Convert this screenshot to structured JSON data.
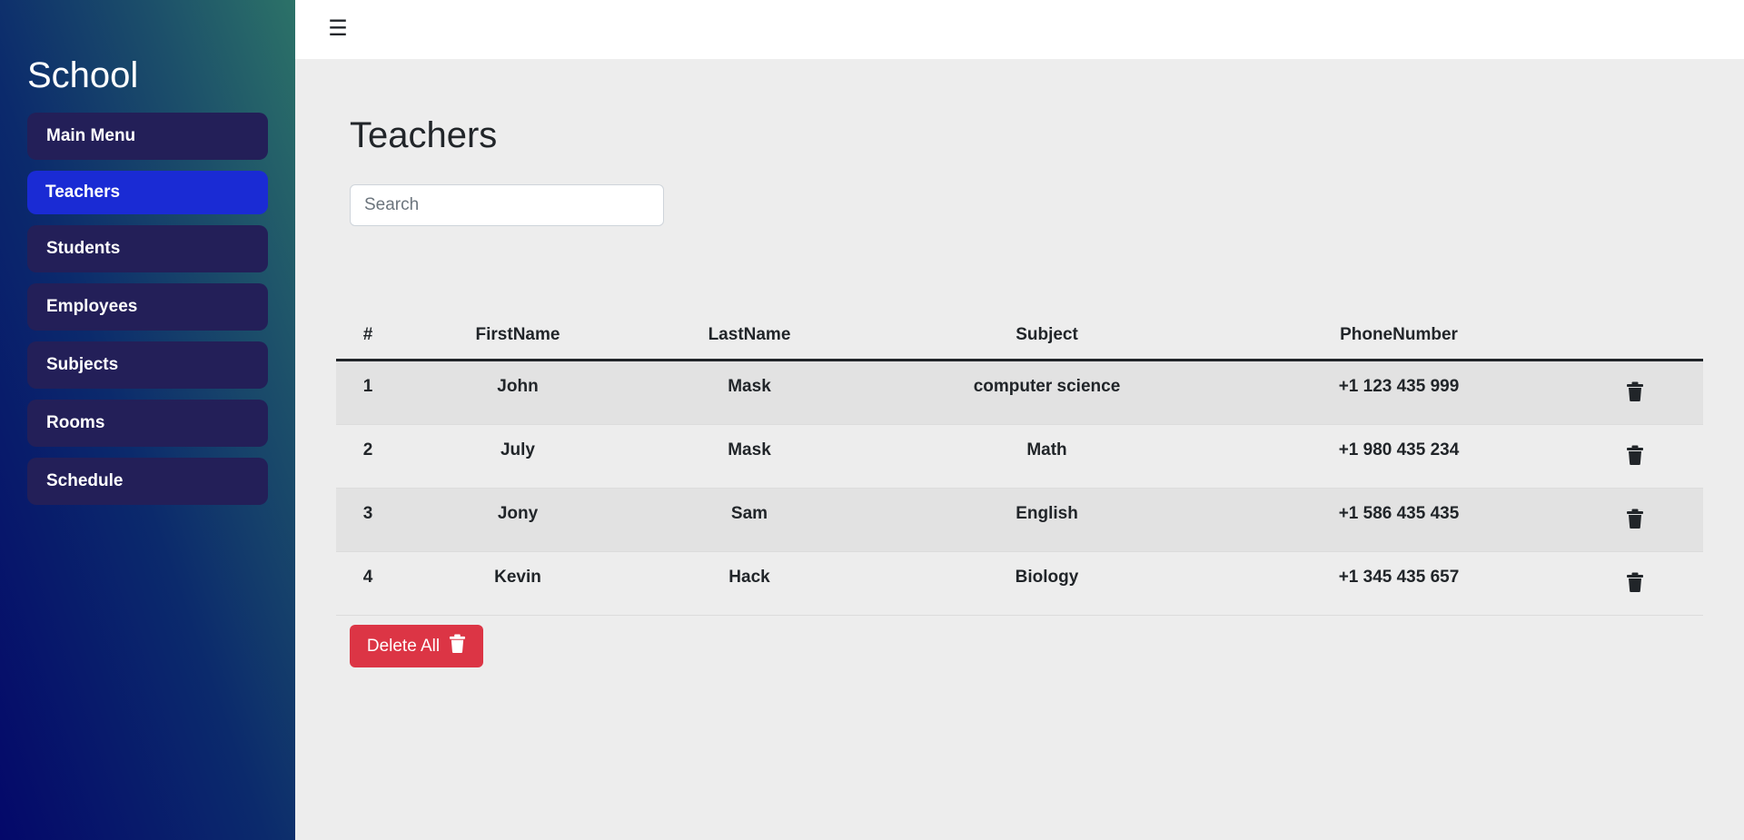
{
  "sidebar": {
    "brand": "School",
    "items": [
      {
        "label": "Main Menu",
        "active": false
      },
      {
        "label": "Teachers",
        "active": true
      },
      {
        "label": "Students",
        "active": false
      },
      {
        "label": "Employees",
        "active": false
      },
      {
        "label": "Subjects",
        "active": false
      },
      {
        "label": "Rooms",
        "active": false
      },
      {
        "label": "Schedule",
        "active": false
      }
    ]
  },
  "topbar": {
    "menu_icon": "hamburger-icon",
    "menu_glyph": "☰"
  },
  "page": {
    "title": "Teachers",
    "search": {
      "placeholder": "Search",
      "value": ""
    }
  },
  "table": {
    "columns": [
      "#",
      "FirstName",
      "LastName",
      "Subject",
      "PhoneNumber",
      ""
    ],
    "rows": [
      {
        "id": "1",
        "first": "John",
        "last": "Mask",
        "subject": "computer science",
        "phone": "+1 123 435 999"
      },
      {
        "id": "2",
        "first": "July",
        "last": "Mask",
        "subject": "Math",
        "phone": "+1 980 435 234"
      },
      {
        "id": "3",
        "first": "Jony",
        "last": "Sam",
        "subject": "English",
        "phone": "+1 586 435 435"
      },
      {
        "id": "4",
        "first": "Kevin",
        "last": "Hack",
        "subject": "Biology",
        "phone": "+1 345 435 657"
      }
    ]
  },
  "actions": {
    "delete_all_label": "Delete All"
  },
  "colors": {
    "sidebar_item": "#231f58",
    "sidebar_active": "#1a2bd4",
    "danger": "#dc3545",
    "content_bg": "#ededed"
  }
}
